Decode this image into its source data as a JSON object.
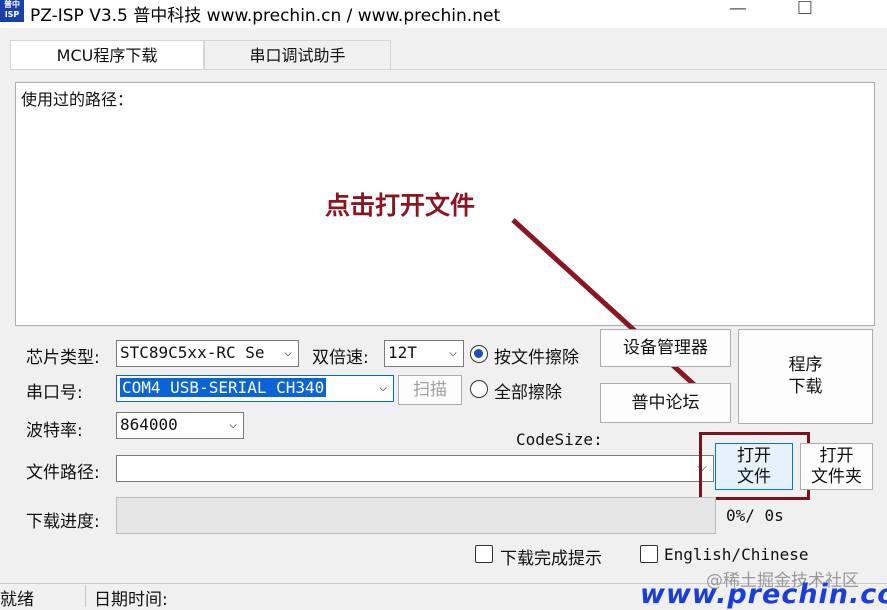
{
  "window": {
    "logo_text": "普中\nISP",
    "title": "PZ-ISP V3.5 普中科技  www.prechin.cn / www.prechin.net",
    "minimize": "—",
    "maximize": "☐"
  },
  "tabs": [
    {
      "label": "MCU程序下载",
      "active": true
    },
    {
      "label": "串口调试助手",
      "active": false
    }
  ],
  "log": {
    "label": "使用过的路径：",
    "annotation": "点击打开文件"
  },
  "form": {
    "chip_type_label": "芯片类型:",
    "chip_type_value": "STC89C5xx-RC Se",
    "double_speed_label": "双倍速:",
    "double_speed_value": "12T",
    "erase_by_file_label": "按文件擦除",
    "erase_all_label": "全部擦除",
    "erase_selected": "按文件擦除",
    "com_port_label": "串口号:",
    "com_port_value": "COM4  USB-SERIAL CH340",
    "scan_label": "扫描",
    "baud_label": "波特率:",
    "baud_value": "864000",
    "code_size_label": "CodeSize:",
    "file_path_label": "文件路径:",
    "file_path_value": "",
    "progress_label": "下载进度:",
    "progress_fraction": 0,
    "progress_text": "0%/ 0s",
    "download_done_label": "下载完成提示",
    "language_label": "English/Chinese"
  },
  "buttons": {
    "device_manager": "设备管理器",
    "forum": "普中论坛",
    "program_download": "程序\n下载",
    "open_file": "打开\n文件",
    "open_folder": "打开\n文件夹"
  },
  "status": {
    "ready": "就绪",
    "datetime_label": "日期时间:"
  },
  "watermark": {
    "juejin": "@稀土掘金技术社区",
    "site": "www.prechin.co"
  },
  "colors": {
    "annotation": "#8b1520",
    "highlight_box": "#7a1220",
    "selection": "#0a64d8",
    "watermark": "#1a3fd8"
  }
}
